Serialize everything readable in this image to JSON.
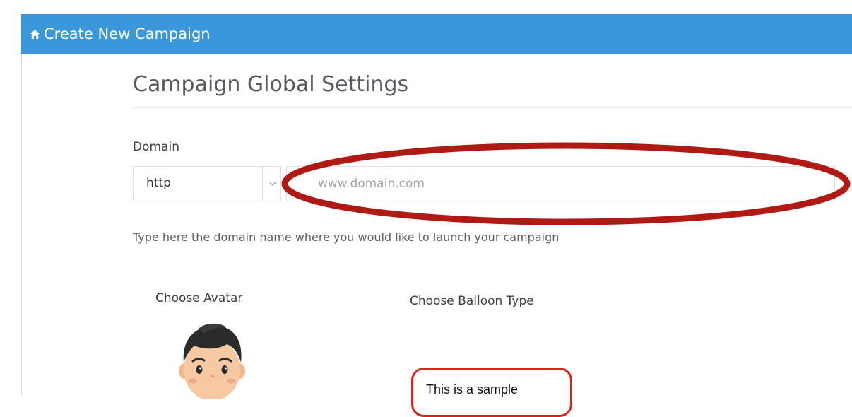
{
  "header": {
    "title": "Create New Campaign",
    "icon": "home-icon",
    "color": "#3a97d9"
  },
  "section": {
    "title": "Campaign Global Settings"
  },
  "domain": {
    "label": "Domain",
    "protocol_value": "http",
    "input_placeholder": "www.domain.com",
    "input_value": "",
    "help_text": "Type here the domain name where you would like to launch your campaign"
  },
  "avatar": {
    "label": "Choose Avatar"
  },
  "balloon": {
    "label": "Choose Balloon Type",
    "sample_text": "This is a sample",
    "border_color": "#e0201a"
  },
  "annotation": {
    "color": "#b01a14"
  }
}
